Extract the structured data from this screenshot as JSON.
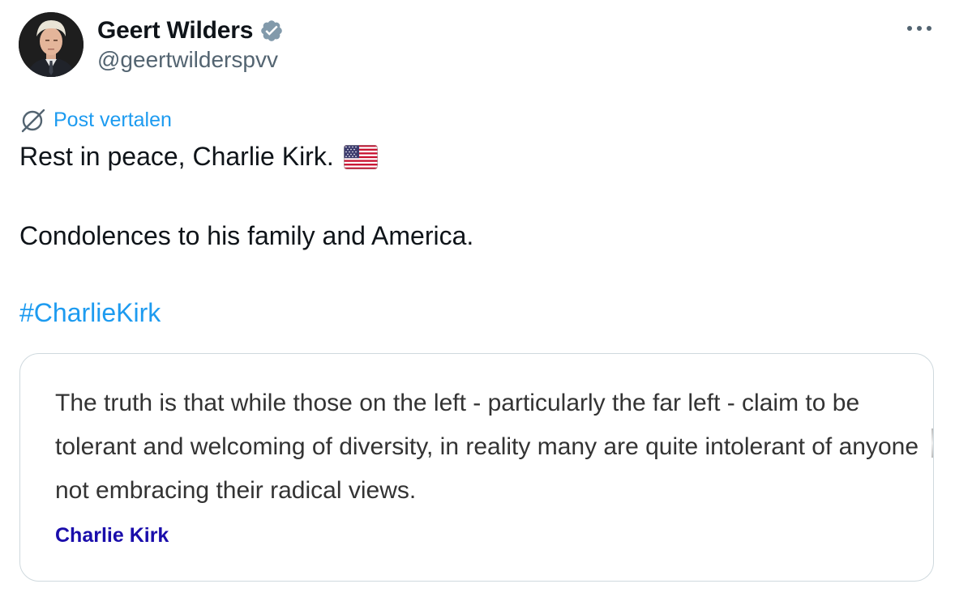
{
  "author": {
    "display_name": "Geert Wilders",
    "handle": "@geertwilderspvv",
    "verified": true,
    "avatar_icon": "portrait-avatar",
    "verified_icon": "verified-badge-icon"
  },
  "header": {
    "more_icon": "more-options-icon"
  },
  "translate": {
    "icon": "translate-globe-icon",
    "label": "Post vertalen"
  },
  "tweet": {
    "line_1": "Rest in peace, Charlie Kirk.",
    "flag_emoji": "🇺🇸",
    "line_2": "Condolences to his family and America.",
    "hashtag": "#CharlieKirk"
  },
  "media": {
    "quote": "The truth is that while those on the left - particularly the far left - claim to be tolerant and welcoming of diversity, in reality many are quite intolerant of anyone not embracing their radical views.",
    "quote_author": "Charlie Kirk"
  },
  "colors": {
    "accent": "#1d9bf0",
    "text_primary": "#0f1419",
    "text_secondary": "#536471",
    "verified": "#829aab",
    "quote_author": "#1a0dab",
    "card_border": "#cfd9de"
  }
}
